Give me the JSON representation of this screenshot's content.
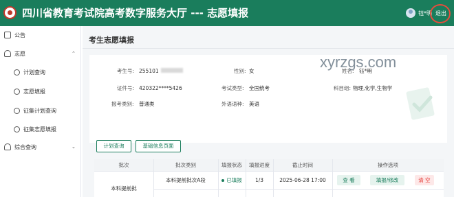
{
  "header": {
    "title": "四川省教育考试院高考数字服务大厅 --- 志愿填报",
    "username": "钰*明",
    "logout_label": "退出"
  },
  "sidebar": {
    "items": [
      {
        "label": "公告",
        "icon": "announcement-icon"
      },
      {
        "label": "志愿",
        "icon": "user-group-icon",
        "expanded": true
      },
      {
        "label": "计划查询",
        "icon": "circle-icon"
      },
      {
        "label": "志愿填报",
        "icon": "circle-icon"
      },
      {
        "label": "征集计划查询",
        "icon": "circle-icon"
      },
      {
        "label": "征集志愿填报",
        "icon": "circle-icon"
      },
      {
        "label": "综合查询",
        "icon": "user-group-icon",
        "expanded": false
      }
    ],
    "collapse_glyph": "‹"
  },
  "main": {
    "page_title": "考生志愿填报",
    "info": {
      "exam_no_label": "考生号:",
      "exam_no_value": "255101",
      "gender_label": "性别:",
      "gender_value": "女",
      "name_label": "姓名:",
      "name_value": "钰*明",
      "id_label": "证件号:",
      "id_value": "420322****5426",
      "exam_type_label": "考试类型:",
      "exam_type_value": "全国统考",
      "subject_label": "科目组:",
      "subject_value": "物理,化学,生物学",
      "category_label": "报考类别:",
      "category_value": "普通类",
      "language_label": "外语语种:",
      "language_value": "英语"
    },
    "watermark": "xyrzgs.com",
    "buttons": {
      "plan_query": "计划查询",
      "basic_info": "基础信息页面"
    },
    "table": {
      "headers": [
        "批次",
        "批次类别",
        "填报状态",
        "填报进度",
        "截止时间",
        "操作选项"
      ],
      "rows": [
        {
          "batch": "本科提前批",
          "category": "本科提前批次A段",
          "status": "已填报",
          "progress": "1/3",
          "deadline": "2025-06-28 17:00",
          "actions": [
            "查 看",
            "填报/修改",
            "清 空"
          ]
        }
      ]
    }
  },
  "colors": {
    "brand": "#1a7d5c",
    "danger": "#e53935",
    "ring": "#e74c3c"
  }
}
